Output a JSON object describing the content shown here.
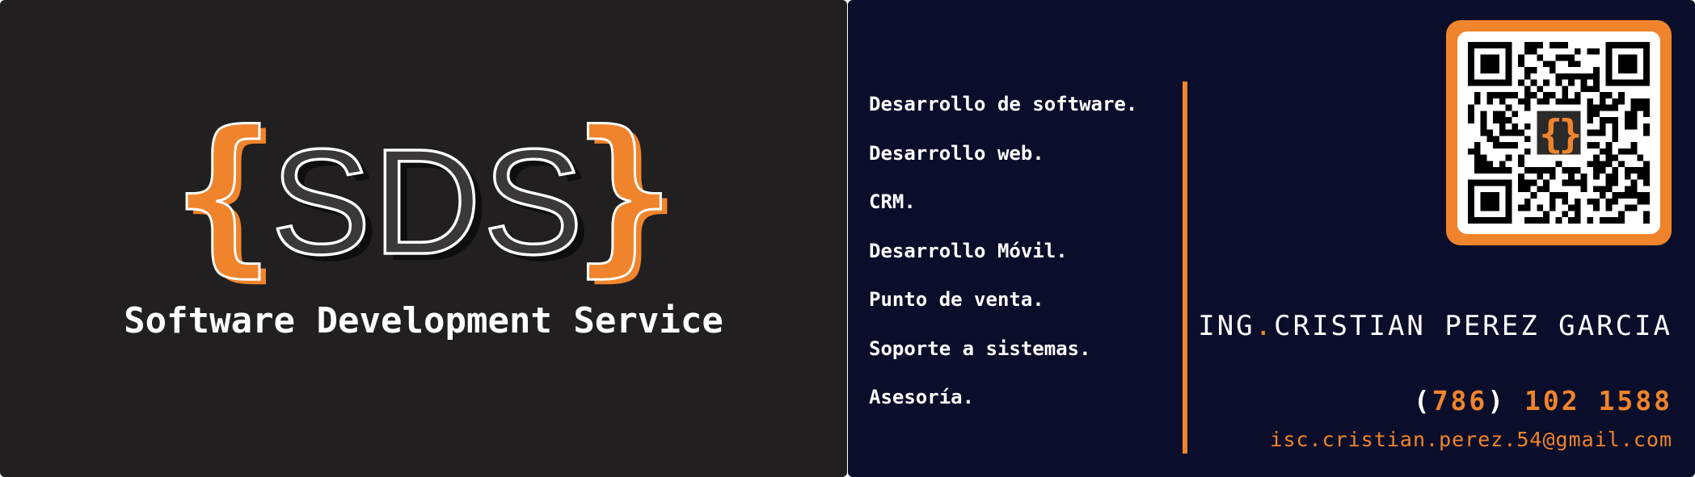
{
  "front": {
    "logo": {
      "brace_open": "{",
      "letters": "SDS",
      "brace_close": "}"
    },
    "tagline": "Software Development Service"
  },
  "back": {
    "services": [
      "Desarrollo de software.",
      "Desarrollo web.",
      "CRM.",
      "Desarrollo Móvil.",
      "Punto de venta.",
      "Soporte a sistemas.",
      "Asesoría."
    ],
    "qr": {
      "icon": "qr-code-icon",
      "center_logo": "{}"
    },
    "name_prefix": "ING",
    "name_separator": ".",
    "name": "CRISTIAN PEREZ GARCIA",
    "phone_open": "(",
    "phone_area": "786",
    "phone_close": ")",
    "phone_number": "102 1588",
    "email": "isc.cristian.perez.54@gmail.com"
  },
  "colors": {
    "front_background": "#211f1f",
    "back_background": "#0a0e2a",
    "accent": "#f0842c",
    "text": "#ffffff",
    "logo_letters_fill": "#3a3838"
  }
}
